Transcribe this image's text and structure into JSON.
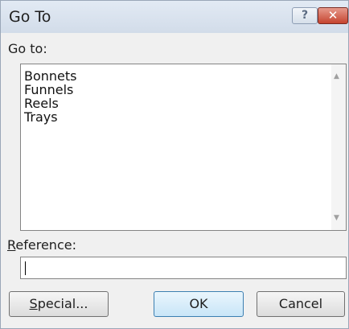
{
  "window": {
    "title": "Go To",
    "help_glyph": "?",
    "close_glyph": "✕"
  },
  "goto": {
    "label": "Go to:",
    "items": [
      "Bonnets",
      "Funnels",
      "Reels",
      "Trays"
    ]
  },
  "reference": {
    "label_first": "R",
    "label_rest": "eference:",
    "value": ""
  },
  "buttons": {
    "special": {
      "first": "S",
      "rest": "pecial..."
    },
    "ok": "OK",
    "cancel": "Cancel"
  },
  "icons": {
    "help": "help-icon",
    "close": "close-icon",
    "scroll_up": "scroll-up-arrow-icon",
    "scroll_down": "scroll-down-arrow-icon"
  },
  "colors": {
    "title_bar": "#d8e2ee",
    "close_button": "#c94d38",
    "default_button": "#c8e5f7"
  }
}
